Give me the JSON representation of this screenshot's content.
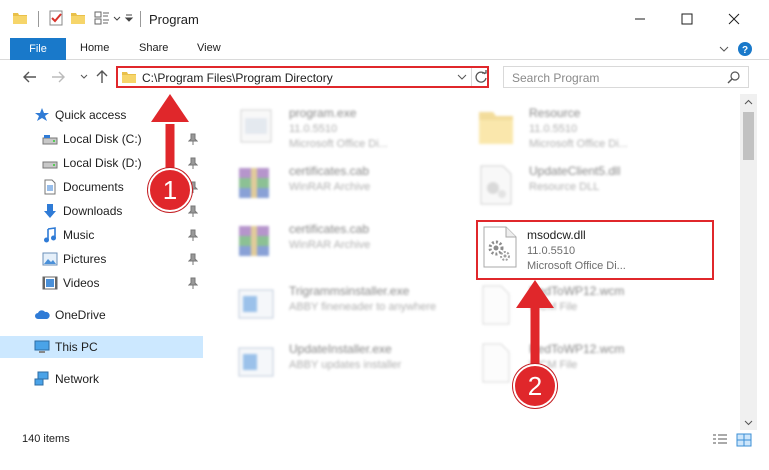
{
  "window": {
    "title": "Program",
    "controls": {
      "minimize": "minimize-icon",
      "maximize": "maximize-icon",
      "close": "close-icon"
    }
  },
  "ribbon": {
    "tabs": [
      {
        "label": "File"
      },
      {
        "label": "Home"
      },
      {
        "label": "Share"
      },
      {
        "label": "View"
      }
    ]
  },
  "address": {
    "path": "C:\\Program Files\\Program Directory"
  },
  "search": {
    "placeholder": "Search Program"
  },
  "sidebar": {
    "items": [
      {
        "label": "Quick access",
        "icon": "star-icon",
        "pinned": false
      },
      {
        "label": "Local Disk (C:)",
        "icon": "drive-icon",
        "pinned": true
      },
      {
        "label": "Local Disk (D:)",
        "icon": "drive-icon",
        "pinned": true
      },
      {
        "label": "Documents",
        "icon": "documents-icon",
        "pinned": true
      },
      {
        "label": "Downloads",
        "icon": "download-icon",
        "pinned": true
      },
      {
        "label": "Music",
        "icon": "music-icon",
        "pinned": true
      },
      {
        "label": "Pictures",
        "icon": "pictures-icon",
        "pinned": true
      },
      {
        "label": "Videos",
        "icon": "videos-icon",
        "pinned": true
      },
      {
        "label": "OneDrive",
        "icon": "cloud-icon",
        "pinned": false
      },
      {
        "label": "This PC",
        "icon": "computer-icon",
        "pinned": false,
        "selected": true
      },
      {
        "label": "Network",
        "icon": "network-icon",
        "pinned": false
      }
    ]
  },
  "files": [
    {
      "name": "program.exe",
      "line2": "11.0.5510",
      "line3": "Microsoft Office Di...",
      "icon": "exe-icon"
    },
    {
      "name": "Resource",
      "line2": "11.0.5510",
      "line3": "Microsoft Office Di...",
      "icon": "folder-icon"
    },
    {
      "name": "certificates.cab",
      "line2": "WinRAR Archive",
      "line3": "",
      "icon": "winrar-icon"
    },
    {
      "name": "UpdateClient5.dll",
      "line2": "Resource DLL",
      "line3": "",
      "icon": "dll-icon"
    },
    {
      "name": "certificates.cab",
      "line2": "WinRAR Archive",
      "line3": "",
      "icon": "winrar-icon"
    },
    {
      "name": "msodcw.dll",
      "line2": "11.0.5510",
      "line3": "Microsoft Office Di...",
      "icon": "dll-icon",
      "highlighted": true
    },
    {
      "name": "Trigrammsinstaller.exe",
      "line2": "ABBY fineneader to anywhere",
      "line3": "",
      "icon": "installer-icon"
    },
    {
      "name": "RedToWP12.wcm",
      "line2": "WCM File",
      "line3": "",
      "icon": "blank-file-icon"
    },
    {
      "name": "UpdateInstaller.exe",
      "line2": "ABBY updates installer",
      "line3": "",
      "icon": "installer-icon"
    },
    {
      "name": "RedToWP12.wcm",
      "line2": "WCM File",
      "line3": "",
      "icon": "blank-file-icon"
    }
  ],
  "status": {
    "item_count": "140 items"
  },
  "annotations": {
    "step1": "1",
    "step2": "2",
    "color": "#e0272b"
  }
}
